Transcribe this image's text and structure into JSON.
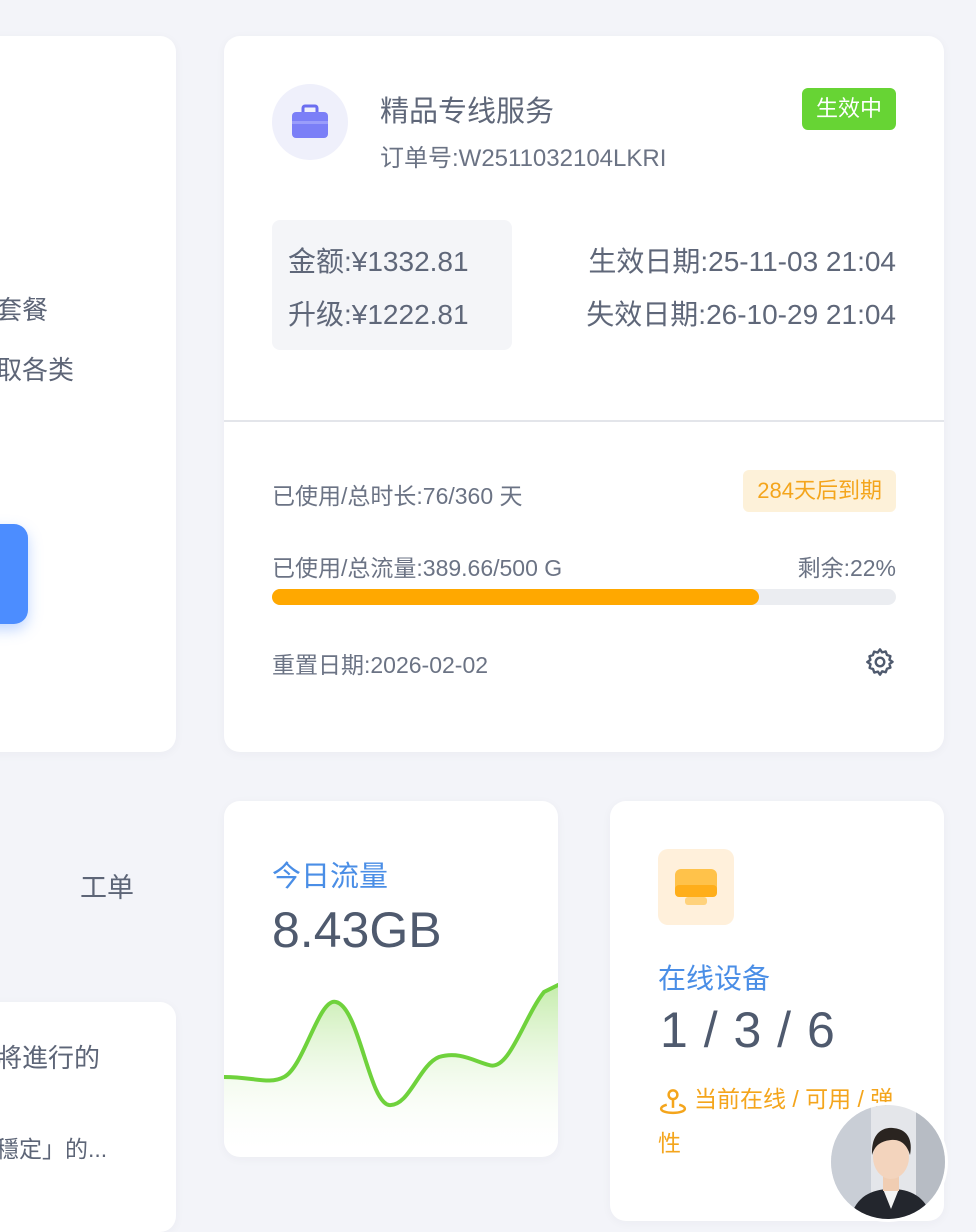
{
  "left_panel": {
    "line1": "套餐",
    "line2": "取各类",
    "ticket_label": "工单",
    "notice_line1": "將進行的",
    "notice_line2": "穩定」的..."
  },
  "service": {
    "title": "精品专线服务",
    "order_label": "订单号:",
    "order_no": "W2511032104LKRI",
    "status": "生效中",
    "amount_label": "金额:",
    "amount": "¥1332.81",
    "upgrade_label": "升级:",
    "upgrade": "¥1222.81",
    "start_label": "生效日期:",
    "start_date": "25-11-03 21:04",
    "end_label": "失效日期:",
    "end_date": "26-10-29 21:04",
    "duration_label": "已使用/总时长:",
    "duration_value": "76/360 天",
    "expiry_badge": "284天后到期",
    "traffic_label": "已使用/总流量:",
    "traffic_value": "389.66/500 G",
    "remaining_label": "剩余:",
    "remaining_value": "22%",
    "used_fraction": 0.78,
    "reset_label": "重置日期:",
    "reset_date": "2026-02-02",
    "icon": "briefcase-icon",
    "settings_icon": "gear-icon"
  },
  "traffic_today": {
    "title": "今日流量",
    "value": "8.43GB"
  },
  "devices": {
    "title": "在线设备",
    "value": "1 / 3 / 6",
    "desc": "当前在线 / 可用 / 弹性",
    "icon": "device-icon",
    "desc_icon": "location-icon"
  },
  "colors": {
    "accent_blue": "#4a8ee6",
    "status_green": "#67d434",
    "warning_orange": "#ffa800",
    "chart_green": "#6fd23c"
  }
}
